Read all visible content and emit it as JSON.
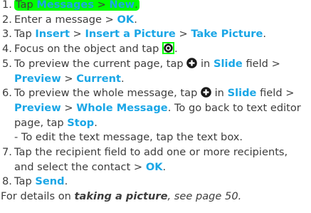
{
  "steps": [
    {
      "num": "1.",
      "prefix": "Tap ",
      "kw1": "Messages",
      "sep": " > ",
      "kw2": "New",
      "end": "."
    },
    {
      "num": "2.",
      "text": "Enter a message > ",
      "kw1": "OK",
      "end": "."
    },
    {
      "num": "3.",
      "prefix": "Tap ",
      "kw1": "Insert",
      "sep1": " > ",
      "kw2": "Insert a Picture",
      "sep2": " > ",
      "kw3": "Take Picture",
      "end": "."
    },
    {
      "num": "4.",
      "text": "Focus on the object and tap ",
      "end": "."
    },
    {
      "num": "5.",
      "text1": "To preview the current page, tap ",
      "text2": " in ",
      "kw1": "Slide",
      "text3": " field > ",
      "kw2": "Preview",
      "sep": " > ",
      "kw3": "Current",
      "end": "."
    },
    {
      "num": "6.",
      "text1": "To preview the whole message, tap ",
      "text2": " in ",
      "kw1": "Slide",
      "text3": " field > ",
      "kw2": "Preview",
      "sep": " > ",
      "kw3": "Whole Message",
      "text4": ". To go back to text editor page, tap ",
      "kw4": "Stop",
      "end": ".",
      "sub": "- To edit the text message, tap the text box."
    },
    {
      "num": "7.",
      "text": "Tap the recipient field to add one or more recipients, and select the contact > ",
      "kw1": "OK",
      "end": "."
    },
    {
      "num": "8.",
      "prefix": "Tap ",
      "kw1": "Send",
      "end": "."
    }
  ],
  "footer": {
    "prefix": "For details on ",
    "emphasis": "taking a picture",
    "suffix": ", see page 50."
  },
  "icons": {
    "camera_shutter": "camera-shutter-icon",
    "add": "plus-circle-icon"
  },
  "colors": {
    "keyword": "#1aa6e6",
    "highlight": "#00ff00",
    "text": "#3d3d3d"
  }
}
